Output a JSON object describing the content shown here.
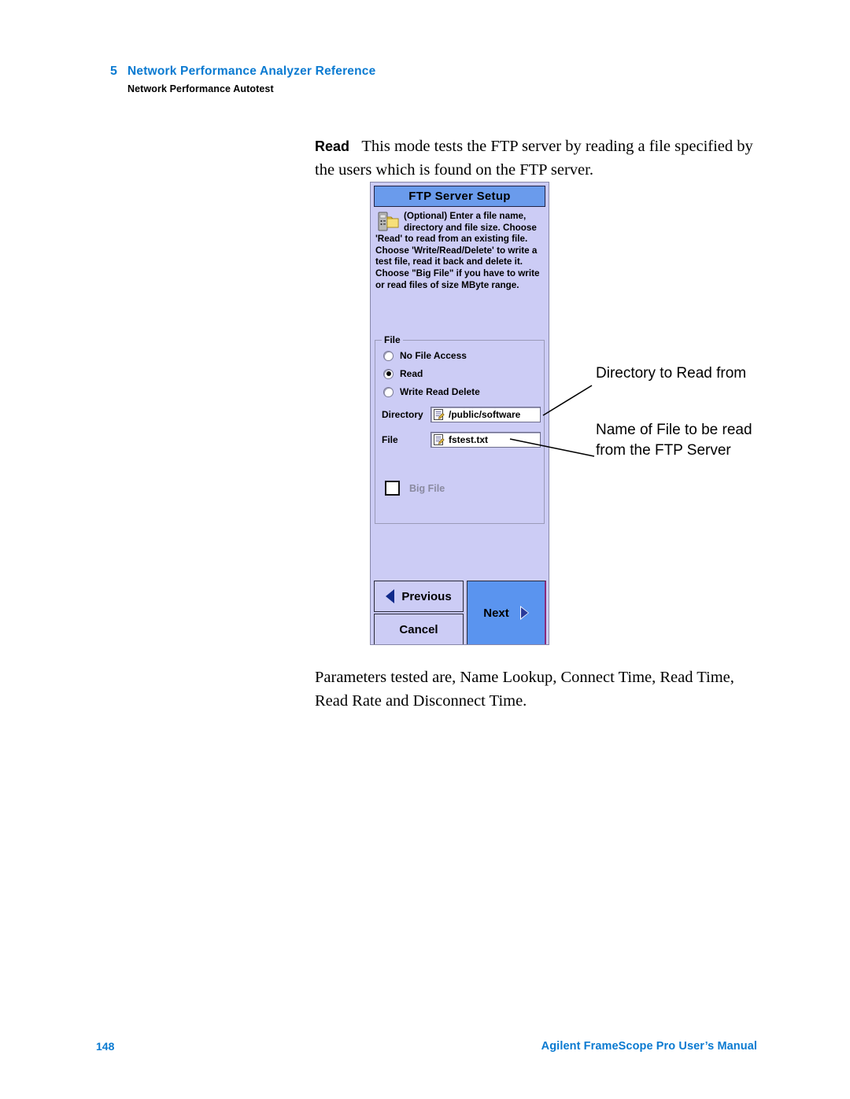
{
  "header": {
    "chapter_number": "5",
    "chapter_title": "Network Performance Analyzer Reference",
    "section_title": "Network Performance Autotest"
  },
  "body": {
    "read_lead_word": "Read",
    "read_paragraph": "This mode tests the FTP server by reading a file specified by the users which is found on the FTP server.",
    "parameters_paragraph": "Parameters tested are, Name Lookup, Connect Time, Read Time, Read Rate and Disconnect Time."
  },
  "dialog": {
    "title": "FTP Server Setup",
    "icon": "server-folder-icon",
    "instructions": "(Optional) Enter a file name, directory and file size.  Choose 'Read' to read from an existing file. Choose 'Write/Read/Delete' to write a test file, read it back and delete it. Choose \"Big File\" if you have to write or read files of size MByte range.",
    "file_group": {
      "legend": "File",
      "radios": [
        {
          "label": "No File Access",
          "selected": false
        },
        {
          "label": "Read",
          "selected": true
        },
        {
          "label": "Write Read Delete",
          "selected": false
        }
      ],
      "fields": [
        {
          "label": "Directory",
          "value": "/public/software",
          "icon": "document-edit-icon"
        },
        {
          "label": "File",
          "value": "fstest.txt",
          "icon": "document-edit-icon"
        }
      ],
      "big_file": {
        "label": "Big File",
        "checked": false,
        "disabled": true
      }
    },
    "buttons": {
      "previous": "Previous",
      "cancel": "Cancel",
      "next": "Next"
    },
    "colors": {
      "titlebar": "#6a9bec",
      "background": "#ccccf5",
      "next_button": "#5a94ef"
    }
  },
  "callouts": {
    "directory": "Directory to Read from",
    "file": "Name of File to be read from the FTP Server"
  },
  "footer": {
    "page_number": "148",
    "manual_title": "Agilent FrameScope Pro User’s Manual"
  },
  "theme": {
    "accent_blue": "#0a7ad1"
  }
}
